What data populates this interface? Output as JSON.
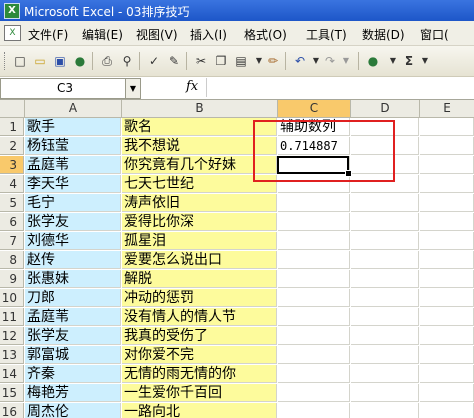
{
  "window": {
    "title": "Microsoft Excel - 03排序技巧",
    "app_icon": "excel-icon"
  },
  "menu": {
    "items": [
      "文件(F)",
      "编辑(E)",
      "视图(V)",
      "插入(I)",
      "格式(O)",
      "工具(T)",
      "数据(D)",
      "窗口("
    ]
  },
  "toolbar": {
    "sigma_label": "Σ"
  },
  "formula_bar": {
    "name_box": "C3",
    "fx_label": "fx",
    "formula": ""
  },
  "columns": [
    "A",
    "B",
    "C",
    "D",
    "E"
  ],
  "rows": [
    {
      "num": "1",
      "a": "歌手",
      "b": "歌名",
      "c": "辅助数列"
    },
    {
      "num": "2",
      "a": "杨钰莹",
      "b": "我不想说",
      "c": "0.714887"
    },
    {
      "num": "3",
      "a": "孟庭苇",
      "b": "你究竟有几个好妹",
      "c": ""
    },
    {
      "num": "4",
      "a": "李天华",
      "b": "七天七世纪",
      "c": ""
    },
    {
      "num": "5",
      "a": "毛宁",
      "b": "涛声依旧",
      "c": ""
    },
    {
      "num": "6",
      "a": "张学友",
      "b": "爱得比你深",
      "c": ""
    },
    {
      "num": "7",
      "a": "刘德华",
      "b": "孤星泪",
      "c": ""
    },
    {
      "num": "8",
      "a": "赵传",
      "b": "爱要怎么说出口",
      "c": ""
    },
    {
      "num": "9",
      "a": "张惠妹",
      "b": "解脱",
      "c": ""
    },
    {
      "num": "10",
      "a": "刀郎",
      "b": "冲动的惩罚",
      "c": ""
    },
    {
      "num": "11",
      "a": "孟庭苇",
      "b": "没有情人的情人节",
      "c": ""
    },
    {
      "num": "12",
      "a": "张学友",
      "b": "我真的受伤了",
      "c": ""
    },
    {
      "num": "13",
      "a": "郭富城",
      "b": "对你爱不完",
      "c": ""
    },
    {
      "num": "14",
      "a": "齐秦",
      "b": "无情的雨无情的你",
      "c": ""
    },
    {
      "num": "15",
      "a": "梅艳芳",
      "b": "一生爱你千百回",
      "c": ""
    },
    {
      "num": "16",
      "a": "周杰伦",
      "b": "一路向北",
      "c": ""
    }
  ],
  "selection": {
    "cell": "C3",
    "active_column": "C",
    "active_row": "3"
  },
  "colors": {
    "col_a_fill": "#cdeffe",
    "col_b_fill": "#fdfb9c",
    "highlight": "#e02020",
    "active_header": "#f9c96b"
  }
}
